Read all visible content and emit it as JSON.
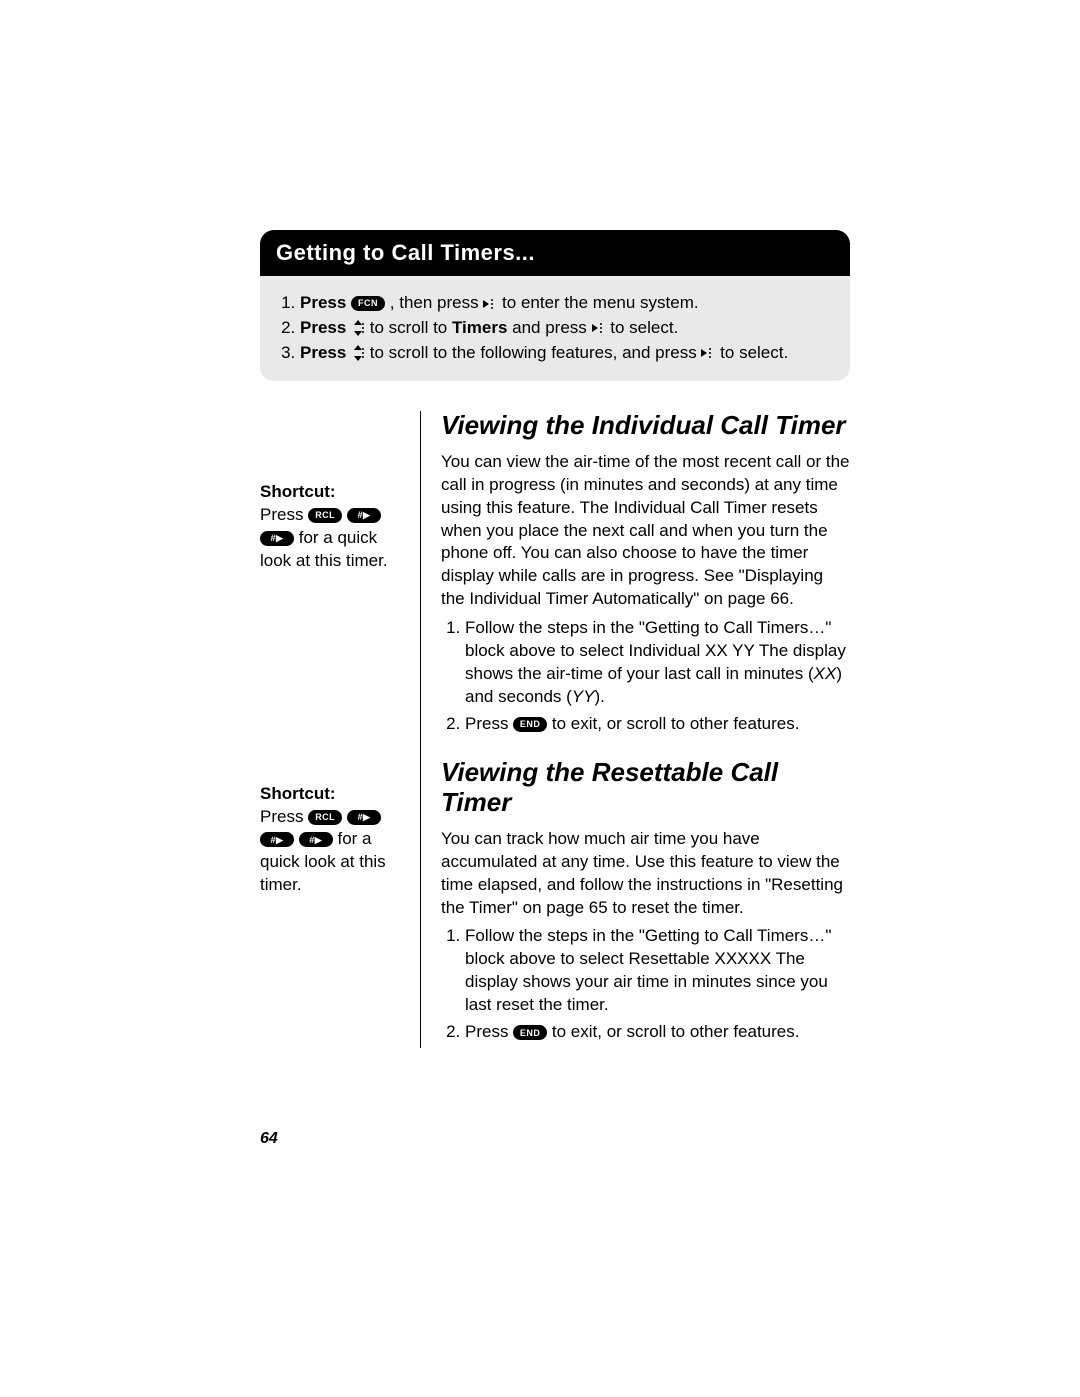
{
  "banner": {
    "title": "Getting to Call Timers..."
  },
  "steps": {
    "s1_label": "1.",
    "s1_a": "Press ",
    "s1_key1": "FCN",
    "s1_b": " , then press ",
    "s1_c": " to enter the menu system.",
    "s2_label": "2.",
    "s2_a": "Press ",
    "s2_b": " to scroll to ",
    "s2_t": "Timers",
    "s2_c": " and press ",
    "s2_d": " to select.",
    "s3_label": "3.",
    "s3_a": "Press ",
    "s3_b": " to scroll to the following features, and press ",
    "s3_c": " to select."
  },
  "shortcut1": {
    "label": "Shortcut:",
    "a": "Press ",
    "k1": "RCL",
    "k2": "#▶",
    "k3": "#▶",
    "b": " for a quick look at this timer."
  },
  "section1": {
    "title": "Viewing the Individual Call Timer",
    "para": "You can view the air-time of the most recent call or the call in progress (in minutes and seconds) at any time using this feature. The Individual Call Timer resets when you place the next call and when you turn the phone off. You can also choose to have the timer display while calls are in progress. See \"Displaying the Individual Timer Automatically\" on page 66.",
    "li1_a": "Follow the steps in the \"Getting to Call Timers…\" block above to select Individual XX YY The display shows the air-time of your last call in minutes (",
    "li1_xx": "XX",
    "li1_b": ") and seconds (",
    "li1_yy": "YY",
    "li1_c": ").",
    "li2_a": "Press ",
    "li2_key": "END",
    "li2_b": " to exit, or scroll to other features."
  },
  "shortcut2": {
    "label": "Shortcut:",
    "a": "Press ",
    "k1": "RCL",
    "k2": "#▶",
    "k3": "#▶",
    "k4": "#▶",
    "b": " for a quick look at this timer."
  },
  "section2": {
    "title": "Viewing the Resettable Call Timer",
    "para": "You can track how much air time you have accumulated at any time. Use this feature to view the time elapsed, and follow the instructions in \"Resetting the Timer\" on page 65 to reset the timer.",
    "li1": "Follow the steps in the \"Getting to Call Timers…\" block above to select Resettable XXXXX The display shows your air time in minutes since you last reset the timer.",
    "li2_a": "Press ",
    "li2_key": "END",
    "li2_b": " to exit, or scroll to other features."
  },
  "pagenum": "64"
}
